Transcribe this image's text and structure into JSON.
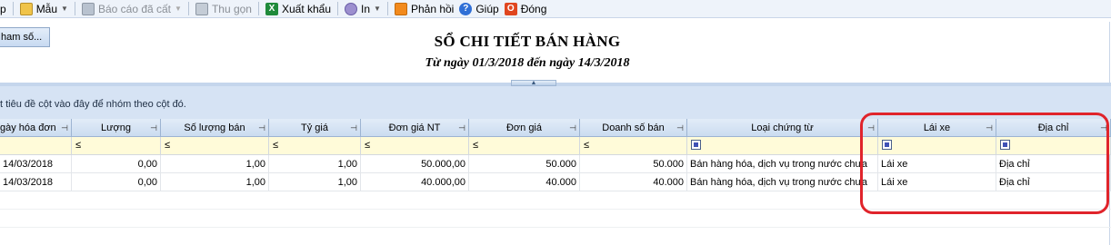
{
  "toolbar": {
    "items": [
      {
        "label": "p",
        "icon": "print-icon",
        "disabled": false
      },
      {
        "label": "Mẫu",
        "icon": "template-icon",
        "disabled": false,
        "dropdown": true
      },
      {
        "label": "Báo cáo đã cất",
        "icon": "saved-report-icon",
        "disabled": true,
        "dropdown": true
      },
      {
        "label": "Thu gọn",
        "icon": "collapse-icon",
        "disabled": true
      },
      {
        "label": "Xuất khẩu",
        "icon": "excel-export-icon",
        "disabled": false
      },
      {
        "label": "In",
        "icon": "printer-icon",
        "disabled": false,
        "dropdown": true
      },
      {
        "label": "Phản hồi",
        "icon": "feedback-mail-icon",
        "disabled": false
      },
      {
        "label": "Giúp",
        "icon": "help-icon",
        "disabled": false
      },
      {
        "label": "Đóng",
        "icon": "close-icon",
        "disabled": false
      }
    ]
  },
  "params_button": "ham số...",
  "report": {
    "title": "SỔ CHI TIẾT BÁN HÀNG",
    "subtitle": "Từ ngày 01/3/2018 đến ngày 14/3/2018"
  },
  "group_panel_text": "t tiêu đề cột vào đây để nhóm theo cột đó.",
  "grid": {
    "columns": [
      {
        "label": "gày hóa đơn",
        "align": "left",
        "filter": ""
      },
      {
        "label": "Lượng",
        "filter": "≤"
      },
      {
        "label": "Số lượng bán",
        "filter": "≤"
      },
      {
        "label": "Tỷ giá",
        "filter": "≤"
      },
      {
        "label": "Đơn giá NT",
        "filter": "≤"
      },
      {
        "label": "Đơn giá",
        "filter": "≤"
      },
      {
        "label": "Doanh số bán",
        "filter": "≤"
      },
      {
        "label": "Loại chứng từ",
        "filter": "checkbox"
      },
      {
        "label": "Lái xe",
        "filter": "checkbox"
      },
      {
        "label": "Địa chỉ",
        "filter": "checkbox"
      }
    ],
    "rows": [
      [
        "14/03/2018",
        "0,00",
        "1,00",
        "1,00",
        "50.000,00",
        "50.000",
        "50.000",
        "Bán hàng hóa, dịch vụ trong nước chưa",
        "Lái xe",
        "Địa chỉ"
      ],
      [
        "14/03/2018",
        "0,00",
        "1,00",
        "1,00",
        "40.000,00",
        "40.000",
        "40.000",
        "Bán hàng hóa, dịch vụ trong nước chưa",
        "Lái xe",
        "Địa chỉ"
      ]
    ]
  },
  "colors": {
    "header_bg": "#cbdcf0",
    "filter_bg": "#fffbd9",
    "group_panel_bg": "#d6e3f4",
    "highlight": "#e0242b"
  }
}
